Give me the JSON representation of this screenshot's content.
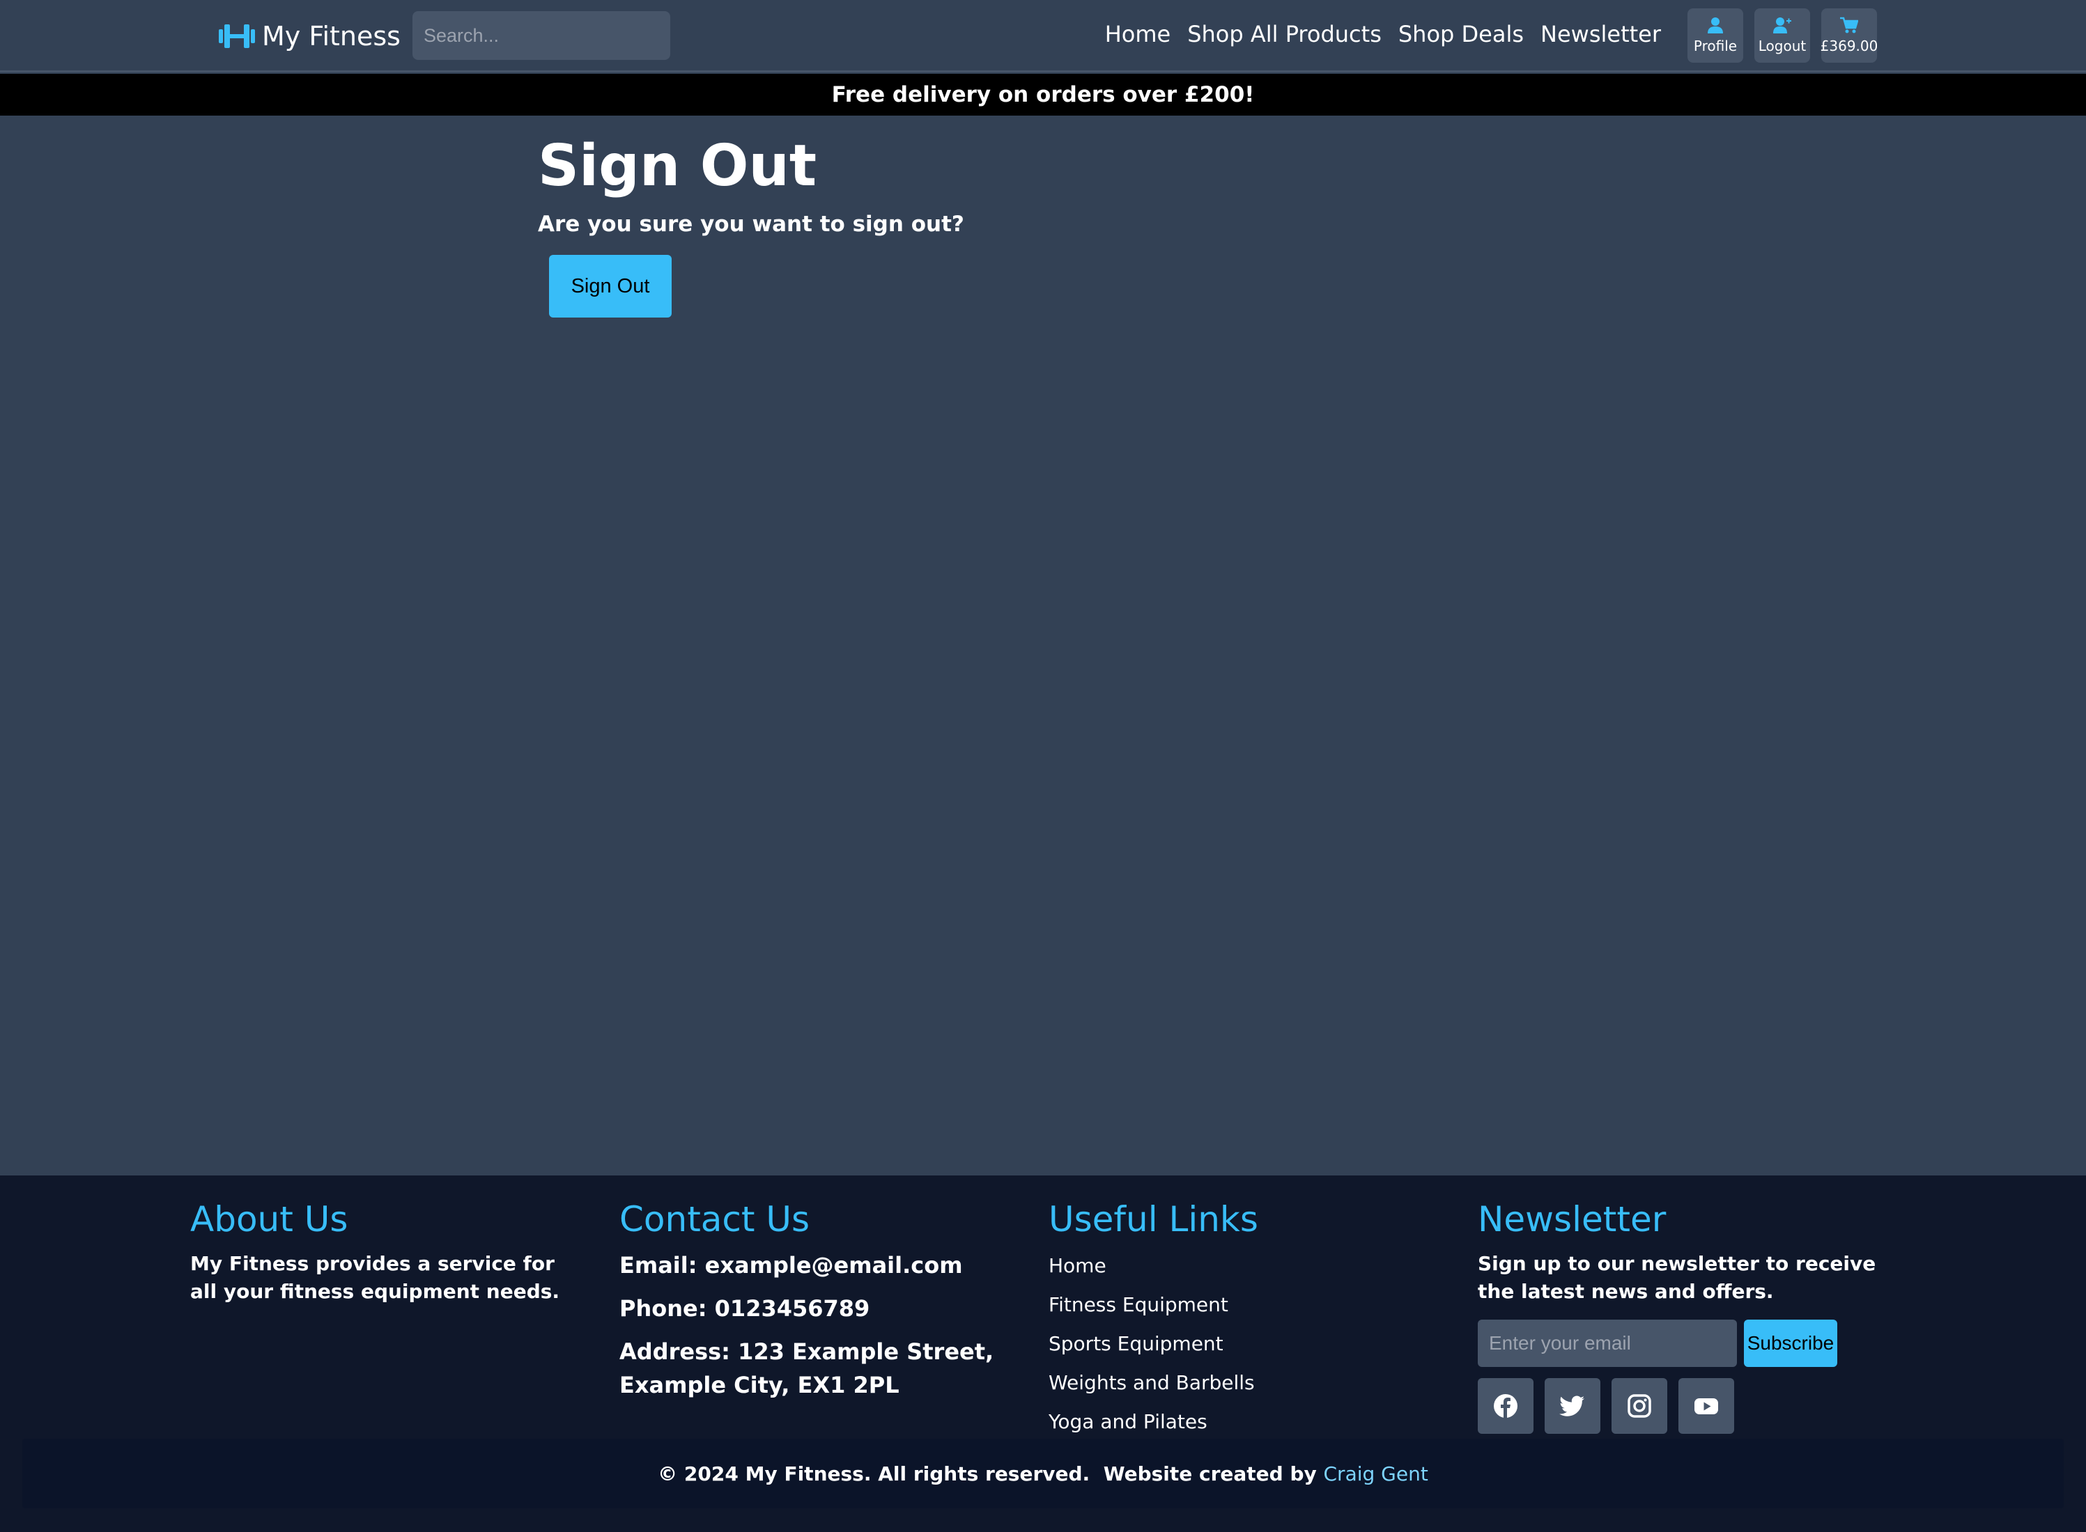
{
  "colors": {
    "accent": "#38bdf8",
    "page_bg": "#334155",
    "footer_bg": "#0f172a",
    "banner_bg": "#000000"
  },
  "navbar": {
    "brand_icon": "dumbbell-icon",
    "brand_name": "My Fitness",
    "search_placeholder": "Search...",
    "links": [
      "Home",
      "Shop All Products",
      "Shop Deals",
      "Newsletter"
    ],
    "profile_label": "Profile",
    "profile_icon": "user-icon",
    "logout_label": "Logout",
    "logout_icon": "user-plus-icon",
    "cart_label": "£369.00",
    "cart_icon": "cart-icon"
  },
  "banner": {
    "text": "Free delivery on orders over £200!"
  },
  "main": {
    "title": "Sign Out",
    "question": "Are you sure you want to sign out?",
    "button_label": "Sign Out"
  },
  "footer": {
    "about": {
      "heading": "About Us",
      "text": "My Fitness provides a service for all your fitness equipment needs."
    },
    "contact": {
      "heading": "Contact Us",
      "email": "Email: example@email.com",
      "phone": "Phone: 0123456789",
      "address": "Address: 123 Example Street, Example City, EX1 2PL"
    },
    "links": {
      "heading": "Useful Links",
      "items": [
        "Home",
        "Fitness Equipment",
        "Sports Equipment",
        "Weights and Barbells",
        "Yoga and Pilates"
      ]
    },
    "newsletter": {
      "heading": "Newsletter",
      "text": "Sign up to our newsletter to receive the latest news and offers.",
      "email_placeholder": "Enter your email",
      "subscribe_label": "Subscribe",
      "socials": [
        "facebook-icon",
        "twitter-icon",
        "instagram-icon",
        "youtube-icon"
      ]
    },
    "copyright": "© 2024 My Fitness. All rights reserved.  Website created by ",
    "credit_name": "Craig Gent"
  }
}
